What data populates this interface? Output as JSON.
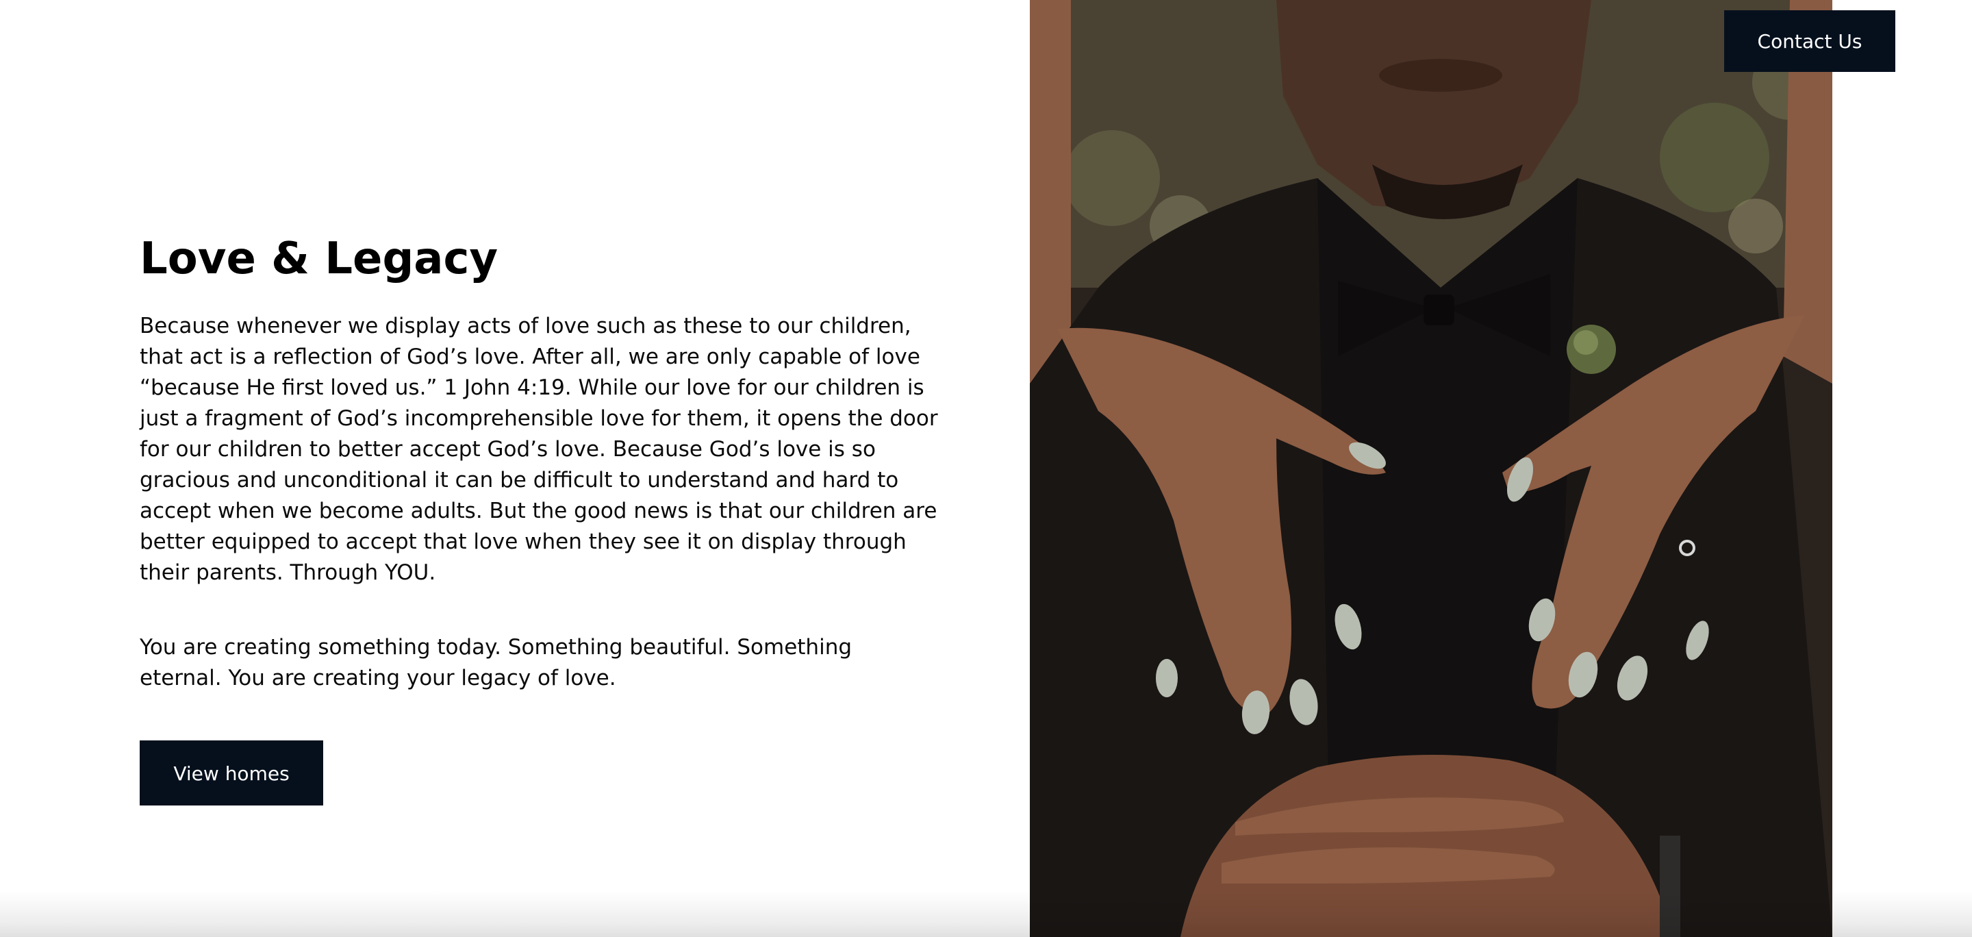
{
  "header": {
    "contact_label": "Contact Us"
  },
  "main": {
    "title": "Love & Legacy",
    "paragraph_1": "Because whenever we display acts of love such as these to our children, that act is a reflection of God’s love. After all, we are only capable of love “because He first loved us.” 1 John 4:19. While our love for our children is just a fragment of God’s incomprehensible love for them, it opens the door for our children to better accept God’s love. Because God’s love is so gracious and unconditional it can be difficult to understand and hard to accept when we become adults. But the good news is that our children are better equipped to accept that love when they see it on display through their parents. Through YOU.",
    "paragraph_2": "You are creating something today. Something beautiful. Something eternal. You are creating your legacy of love.",
    "view_homes_label": "View homes"
  },
  "photo": {
    "icon": "couple-hands-on-shoulders-photo"
  },
  "colors": {
    "button_bg": "#06101d",
    "button_text": "#ffffff",
    "heading": "#000000",
    "body_text": "#0b0b0b"
  }
}
